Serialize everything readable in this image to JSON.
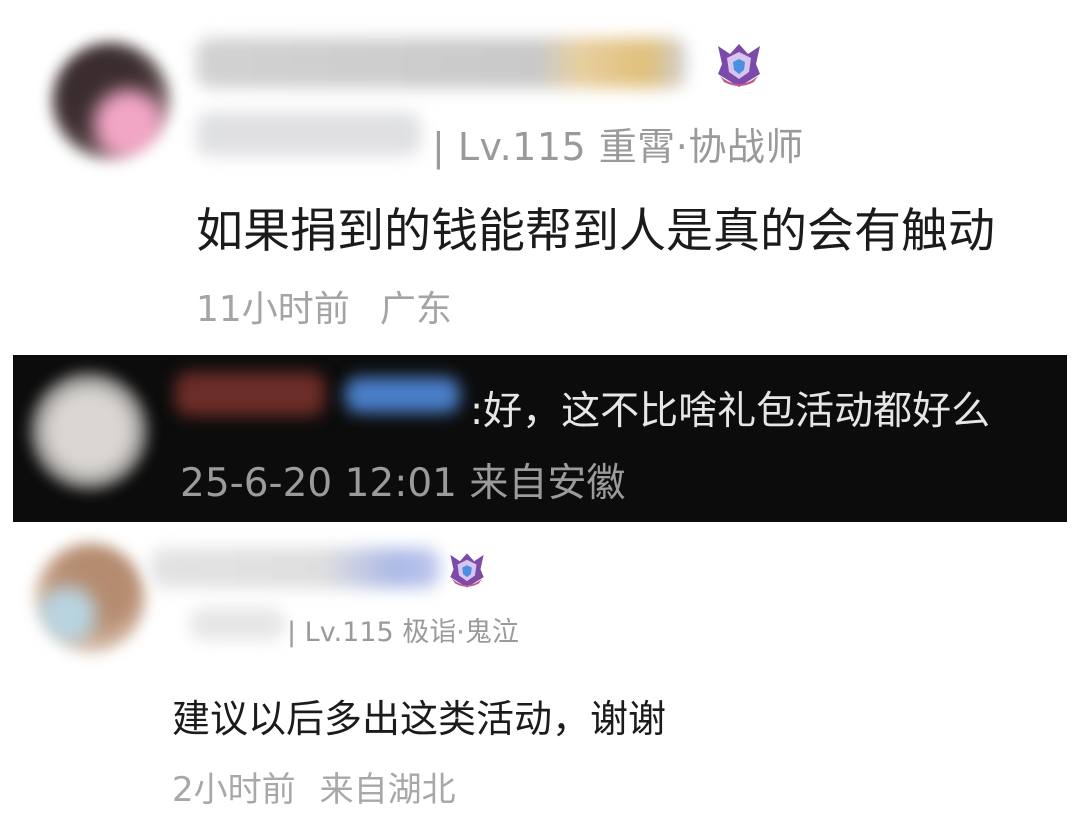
{
  "comments": [
    {
      "level_text": "| Lv.115 重霄·协战师",
      "text": "如果捐到的钱能帮到人是真的会有触动",
      "time": "11小时前",
      "location": "广东",
      "badge_icon": "crest-badge-icon"
    },
    {
      "text": ":好，这不比啥礼包活动都好么",
      "meta": "25-6-20 12:01 来自安徽"
    },
    {
      "level_text": "| Lv.115 极诣·鬼泣",
      "text": "建议以后多出这类活动，谢谢",
      "time": "2小时前",
      "location": "来自湖北",
      "badge_icon": "crest-badge-icon"
    }
  ],
  "colors": {
    "dark_panel": "#0c0c0c",
    "meta_gray": "#9a9a9a",
    "badge_purple": "#7c4aa8"
  }
}
